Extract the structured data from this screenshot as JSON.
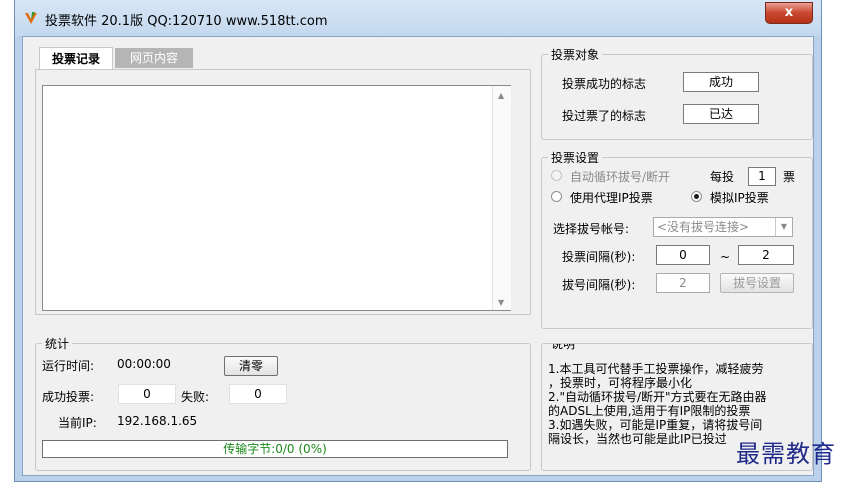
{
  "window": {
    "title": "投票软件 20.1版  QQ:120710  www.518tt.com",
    "close_label": "x"
  },
  "tabs": [
    {
      "label": "投票记录",
      "active": true
    },
    {
      "label": "网页内容",
      "active": false
    }
  ],
  "log": {
    "content": ""
  },
  "vote_target": {
    "legend": "投票对象",
    "success_label": "投票成功的标志",
    "success_value": "成功",
    "voted_label": "投过票了的标志",
    "voted_value": "已达"
  },
  "vote_settings": {
    "legend": "投票设置",
    "auto_dial_label": "自动循环拔号/断开",
    "per_vote_prefix": "每投",
    "per_vote_value": "1",
    "per_vote_suffix": "票",
    "proxy_label": "使用代理IP投票",
    "simulate_label": "模拟IP投票",
    "dial_account_label": "选择拔号帐号:",
    "dial_account_value": "<没有拔号连接>",
    "interval_label": "投票间隔(秒):",
    "interval_min": "0",
    "interval_sep": "~",
    "interval_max": "2",
    "dial_interval_label": "拔号间隔(秒):",
    "dial_interval_value": "2",
    "dial_settings_button": "拔号设置"
  },
  "stats": {
    "legend": "统计",
    "runtime_label": "运行时间:",
    "runtime_value": "00:00:00",
    "clear_button": "清零",
    "success_label": "成功投票:",
    "success_value": "0",
    "fail_label": "失败:",
    "fail_value": "0",
    "ip_label": "当前IP:",
    "ip_value": "192.168.1.65",
    "progress_text": "传输字节:0/0 (0%)",
    "progress_percent": 0
  },
  "info": {
    "legend": "说明",
    "lines": [
      "1.本工具可代替手工投票操作，减轻疲劳",
      "，投票时，可将程序最小化",
      "2.\"自动循环拔号/断开\"方式要在无路由器",
      "的ADSL上使用,适用于有IP限制的投票",
      "3.如遇失败，可能是IP重复，请将拔号间",
      "隔设长，当然也可能是此IP已投过"
    ]
  },
  "watermark": "最需教育",
  "colors": {
    "title_bar": "#c3d8ee",
    "client_bg": "#f0f0f0",
    "progress_text": "#1a8a1a",
    "close_button": "#c9472e"
  }
}
